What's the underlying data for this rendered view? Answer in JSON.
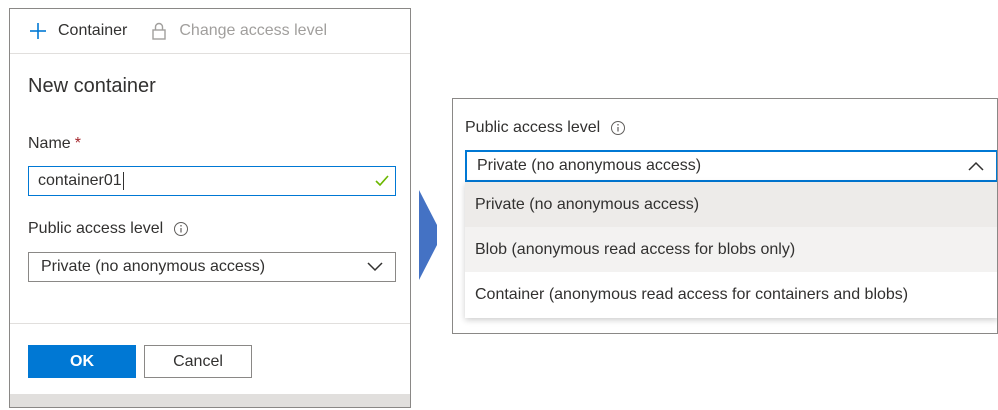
{
  "toolbar": {
    "add_container_label": "Container",
    "change_access_label": "Change access level"
  },
  "new_container": {
    "title": "New container",
    "name_label": "Name",
    "required_marker": "*",
    "name_value": "container01",
    "access_label": "Public access level",
    "access_value": "Private (no anonymous access)",
    "ok_label": "OK",
    "cancel_label": "Cancel"
  },
  "dropdown_panel": {
    "access_label": "Public access level",
    "selected_value": "Private (no anonymous access)",
    "options": [
      "Private (no anonymous access)",
      "Blob (anonymous read access for blobs only)",
      "Container (anonymous read access for containers and blobs)"
    ]
  },
  "colors": {
    "accent": "#0078d4",
    "required": "#a4262c",
    "valid_check": "#6bb700",
    "arrow": "#4472c4"
  },
  "icons": [
    "plus-icon",
    "lock-icon",
    "info-icon",
    "check-icon",
    "chevron-down-icon",
    "chevron-up-icon"
  ]
}
